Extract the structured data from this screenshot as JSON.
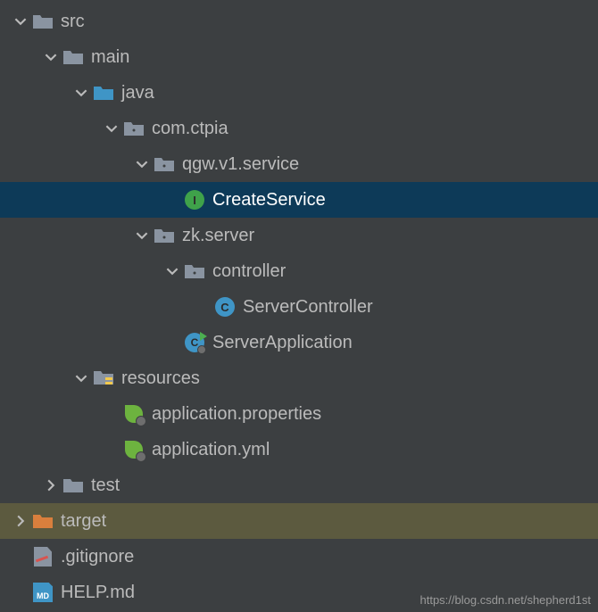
{
  "tree": {
    "src": {
      "label": "src",
      "expanded": true
    },
    "main": {
      "label": "main",
      "expanded": true
    },
    "java": {
      "label": "java",
      "expanded": true
    },
    "com_ctpia": {
      "label": "com.ctpia",
      "expanded": true
    },
    "qgw_service": {
      "label": "qgw.v1.service",
      "expanded": true
    },
    "create_service": {
      "label": "CreateService"
    },
    "zk_server": {
      "label": "zk.server",
      "expanded": true
    },
    "controller": {
      "label": "controller",
      "expanded": true
    },
    "server_controller": {
      "label": "ServerController"
    },
    "server_application": {
      "label": "ServerApplication"
    },
    "resources": {
      "label": "resources",
      "expanded": true
    },
    "app_props": {
      "label": "application.properties"
    },
    "app_yml": {
      "label": "application.yml"
    },
    "test": {
      "label": "test",
      "expanded": false
    },
    "target": {
      "label": "target",
      "expanded": false
    },
    "gitignore": {
      "label": ".gitignore"
    },
    "help_md": {
      "label": "HELP.md"
    }
  },
  "watermark": "https://blog.csdn.net/shepherd1st"
}
